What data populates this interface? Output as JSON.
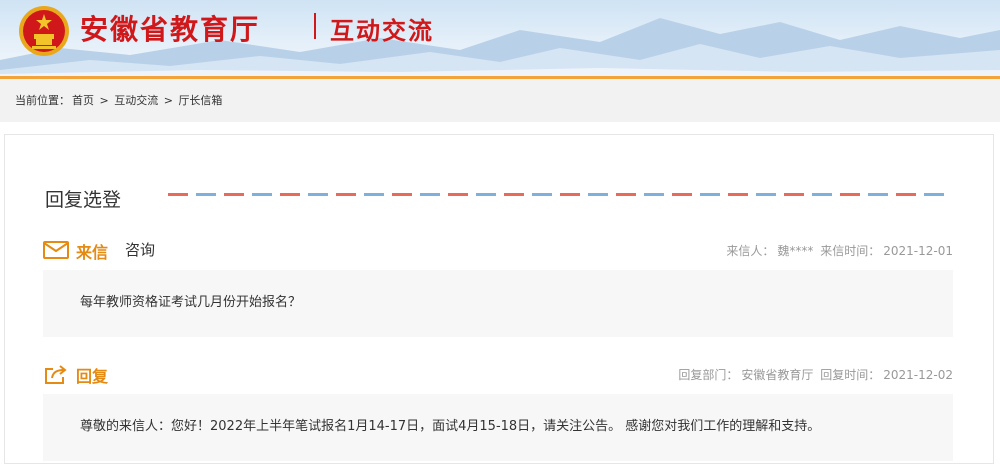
{
  "header": {
    "site_title": "安徽省教育厅",
    "section_title": "互动交流",
    "colors": {
      "brand_red": "#d0181a",
      "accent_orange": "#f2a33a"
    }
  },
  "breadcrumb": {
    "prefix": "当前位置：",
    "items": [
      "首页",
      "互动交流",
      "厅长信箱"
    ],
    "separator": ">"
  },
  "main": {
    "heading": "回复选登",
    "letter": {
      "icon": "envelope-icon",
      "label": "来信",
      "topic": "咨询",
      "sender_label": "来信人：",
      "sender": "魏****",
      "time_label": "来信时间：",
      "time": "2021-12-01",
      "content": "每年教师资格证考试几月份开始报名？"
    },
    "reply": {
      "icon": "reply-share-icon",
      "label": "回复",
      "dept_label": "回复部门：",
      "dept": "安徽省教育厅",
      "time_label": "回复时间：",
      "time": "2021-12-02",
      "content": "尊敬的来信人：您好！2022年上半年笔试报名1月14-17日，面试4月15-18日，请关注公告。 感谢您对我们工作的理解和支持。"
    }
  }
}
